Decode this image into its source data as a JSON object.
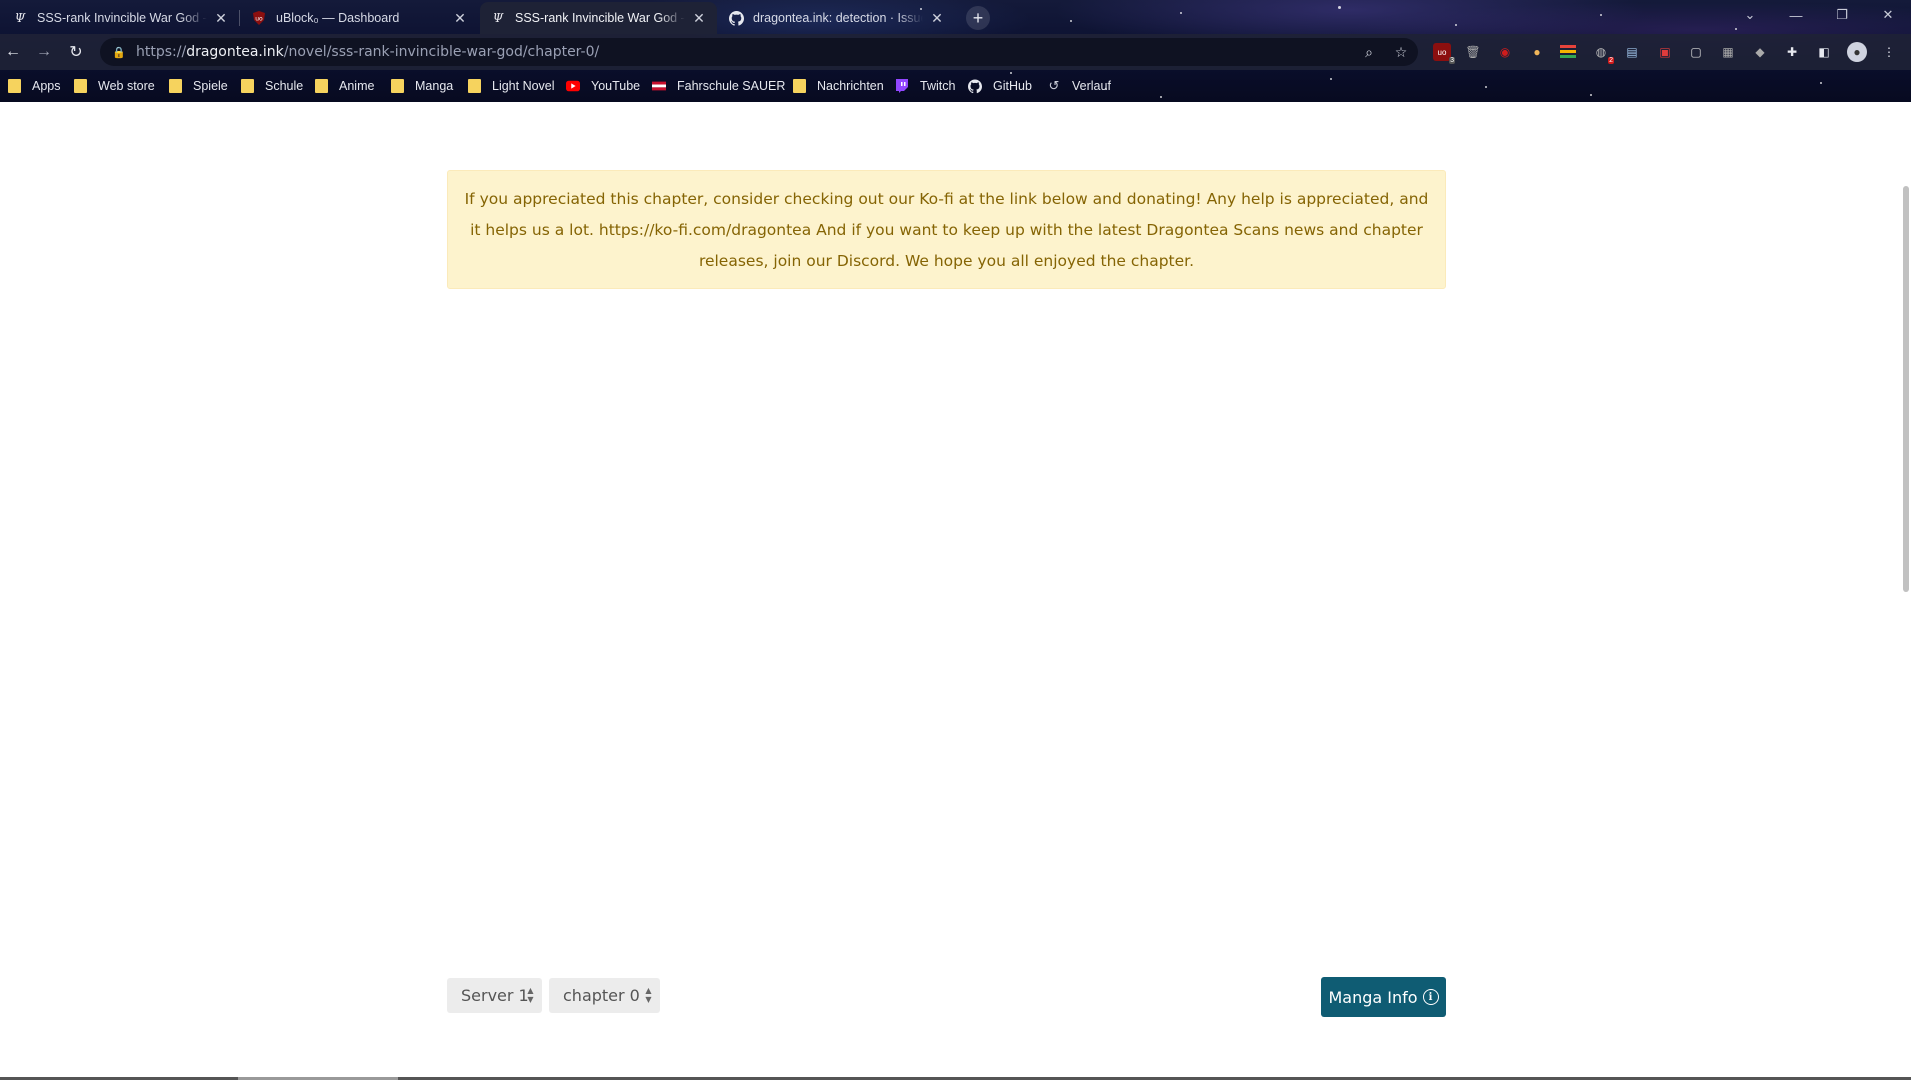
{
  "browser": {
    "tabs": [
      {
        "title": "SSS-rank Invincible War God - ch",
        "favicon": "dragontea-icon",
        "active": false
      },
      {
        "title": "uBlock₀ — Dashboard",
        "favicon": "ublock-icon",
        "active": false
      },
      {
        "title": "SSS-rank Invincible War God - ch",
        "favicon": "dragontea-icon",
        "active": true
      },
      {
        "title": "dragontea.ink: detection · Issue #",
        "favicon": "github-icon",
        "active": false
      }
    ],
    "new_tab_symbol": "+",
    "url_prefix": "https://",
    "url_host": "dragontea.ink",
    "url_path": "/novel/sss-rank-invincible-war-god/chapter-0/",
    "bookmarks": [
      {
        "label": "Apps",
        "icon": "folder-icon"
      },
      {
        "label": "Web store",
        "icon": "folder-icon"
      },
      {
        "label": "Spiele",
        "icon": "folder-icon"
      },
      {
        "label": "Schule",
        "icon": "folder-icon"
      },
      {
        "label": "Anime",
        "icon": "folder-icon"
      },
      {
        "label": "Manga",
        "icon": "folder-icon"
      },
      {
        "label": "Light Novel",
        "icon": "folder-icon"
      },
      {
        "label": "YouTube",
        "icon": "youtube-icon"
      },
      {
        "label": "Fahrschule SAUER",
        "icon": "flag-icon"
      },
      {
        "label": "Nachrichten",
        "icon": "folder-icon"
      },
      {
        "label": "Twitch",
        "icon": "twitch-icon"
      },
      {
        "label": "GitHub",
        "icon": "github-icon"
      },
      {
        "label": "Verlauf",
        "icon": "history-icon"
      }
    ],
    "extension_badges": {
      "ublock": "3",
      "red": "2"
    }
  },
  "page": {
    "notice": "If you appreciated this chapter, consider checking out our Ko-fi at the link below and donating! Any help is appreciated, and it helps us a lot. https://ko-fi.com/dragontea And if you want to keep up with the latest Dragontea Scans news and chapter releases, join our Discord. We hope you all enjoyed the chapter.",
    "server_select": "Server 1",
    "chapter_select": "chapter 0",
    "manga_info_label": "Manga Info"
  },
  "colors": {
    "notice_bg": "#fdf3cd",
    "notice_text": "#856404",
    "button_bg": "#0f5c73"
  }
}
